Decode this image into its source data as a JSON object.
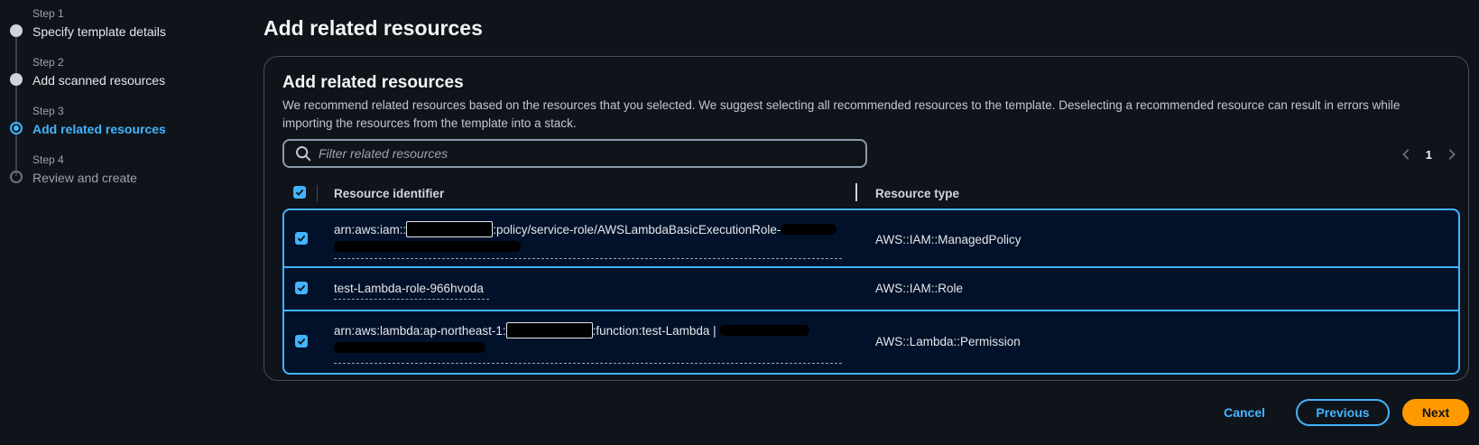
{
  "stepper": {
    "steps": [
      {
        "label": "Step 1",
        "title": "Specify template details",
        "state": "complete"
      },
      {
        "label": "Step 2",
        "title": "Add scanned resources",
        "state": "complete"
      },
      {
        "label": "Step 3",
        "title": "Add related resources",
        "state": "active"
      },
      {
        "label": "Step 4",
        "title": "Review and create",
        "state": "upcoming"
      }
    ]
  },
  "page": {
    "title": "Add related resources"
  },
  "container": {
    "title": "Add related resources",
    "description": "We recommend related resources based on the resources that you selected. We suggest selecting all recommended resources to the template. Deselecting a recommended resource can result in errors while importing the resources from the template into a stack."
  },
  "search": {
    "placeholder": "Filter related resources",
    "icon": "search-icon"
  },
  "pagination": {
    "current_page": "1"
  },
  "table": {
    "headers": {
      "identifier": "Resource identifier",
      "type": "Resource type"
    },
    "rows": [
      {
        "identifier_prefix": "arn:aws:iam::",
        "identifier_suffix": ":policy/service-role/AWSLambdaBasicExecutionRole-",
        "type": "AWS::IAM::ManagedPolicy",
        "checked": true
      },
      {
        "identifier": "test-Lambda-role-966hvoda",
        "type": "AWS::IAM::Role",
        "checked": true
      },
      {
        "identifier_prefix": "arn:aws:lambda:ap-northeast-1:",
        "identifier_suffix": ":function:test-Lambda | ",
        "type": "AWS::Lambda::Permission",
        "checked": true
      }
    ]
  },
  "footer": {
    "cancel_label": "Cancel",
    "previous_label": "Previous",
    "next_label": "Next"
  },
  "colors": {
    "accent": "#42b4ff",
    "primary_button": "#ff9900",
    "background": "#0f141a",
    "selected_row": "#001129"
  }
}
